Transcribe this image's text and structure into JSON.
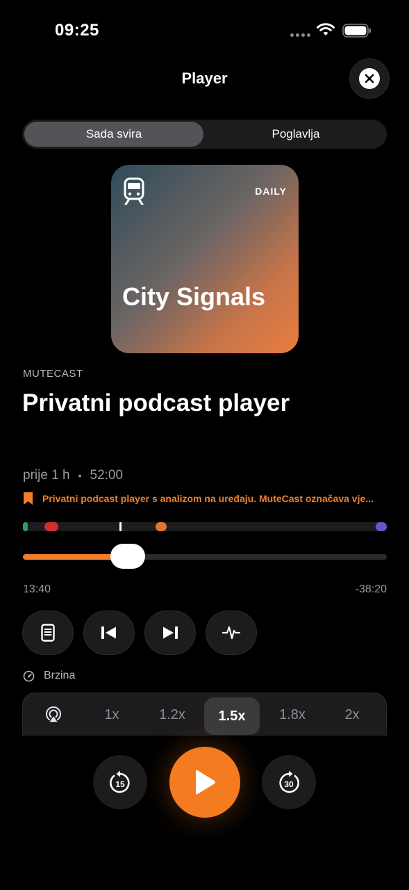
{
  "status_bar": {
    "time": "09:25"
  },
  "nav": {
    "title": "Player"
  },
  "segments": [
    {
      "label": "Sada svira",
      "active": true
    },
    {
      "label": "Poglavlja",
      "active": false
    }
  ],
  "artwork": {
    "badge": "DAILY",
    "title": "City Signals",
    "icon": "train-icon"
  },
  "episode": {
    "kicker": "MUTECAST",
    "title": "Privatni podcast player",
    "age": "prije 1 h",
    "separator": "•",
    "duration": "52:00",
    "description": "Privatni podcast player s analizom na uređaju. MuteCast označava vje..."
  },
  "chapters": [
    {
      "position": 0.0,
      "color": "#2f9e5a"
    },
    {
      "position": 0.06,
      "color": "#d12f2f"
    },
    {
      "position": 0.265,
      "color": "#ffffff"
    },
    {
      "position": 0.365,
      "color": "#e0772e"
    },
    {
      "position": 0.985,
      "color": "#6a55c8"
    }
  ],
  "playback": {
    "progress": 0.258,
    "elapsed": "13:40",
    "remaining": "-38:20"
  },
  "actions": [
    {
      "name": "transcript-button",
      "icon": "document-icon"
    },
    {
      "name": "previous-chapter-button",
      "icon": "skip-back-icon"
    },
    {
      "name": "next-chapter-button",
      "icon": "skip-forward-icon"
    },
    {
      "name": "waveform-button",
      "icon": "waveform-icon"
    }
  ],
  "speed": {
    "label": "Brzina",
    "options": [
      "1x",
      "1.2x",
      "1.5x",
      "1.8x",
      "2x"
    ],
    "selected": "1.5x"
  },
  "transport": {
    "rewind": "15",
    "forward": "30"
  },
  "colors": {
    "accent": "#f47b20",
    "surface": "#1c1c1e",
    "background": "#000000"
  }
}
